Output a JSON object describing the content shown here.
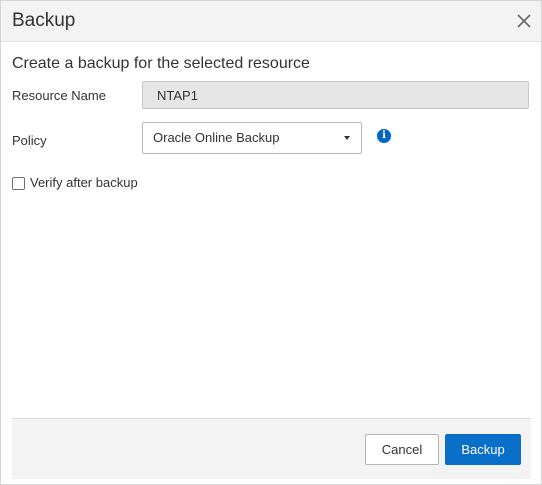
{
  "dialog": {
    "title": "Backup",
    "close_icon": "close-icon",
    "subtitle": "Create a backup for the selected resource"
  },
  "form": {
    "resource_name_label": "Resource Name",
    "resource_name_value": "NTAP1",
    "policy_label": "Policy",
    "policy_value": "Oracle Online Backup",
    "policy_icon": "chevron-down-icon",
    "info_icon": "info-icon",
    "verify_label": "Verify after backup",
    "verify_checked": false
  },
  "footer": {
    "cancel_label": "Cancel",
    "backup_label": "Backup"
  },
  "colors": {
    "primary": "#0a6fc9",
    "header_bg": "#f3f3f3",
    "readonly_bg": "#e5e5e5",
    "info": "#0067c5"
  }
}
